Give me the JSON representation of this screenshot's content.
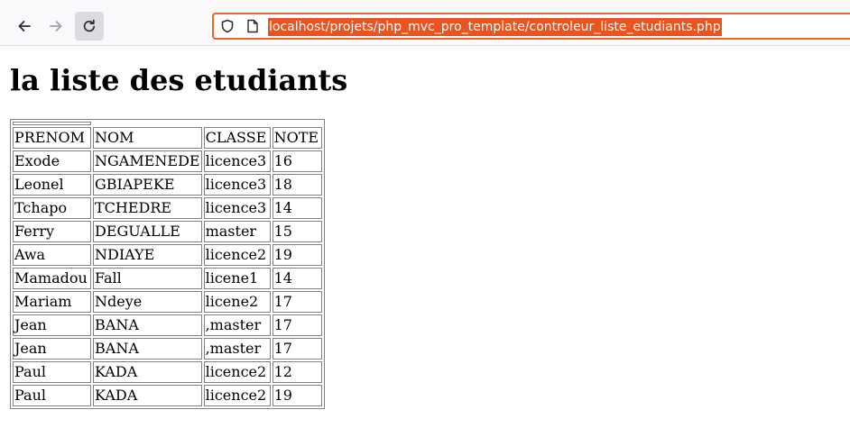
{
  "browser": {
    "url": "localhost/projets/php_mvc_pro_template/controleur_liste_etudiants.php",
    "icons": {
      "back": "arrow-left-icon",
      "forward": "arrow-right-icon",
      "reload": "reload-icon",
      "security": "shield-icon",
      "page": "page-icon"
    },
    "accent_color": "#e95420"
  },
  "page": {
    "title": "la liste des etudiants"
  },
  "table": {
    "headers": [
      "PRENOM",
      "NOM",
      "CLASSE",
      "NOTE"
    ],
    "rows": [
      [
        "Exode",
        "NGAMENEDE",
        "licence3",
        "16"
      ],
      [
        "Leonel",
        "GBIAPEKE",
        "licence3",
        "18"
      ],
      [
        "Tchapo",
        "TCHEDRE",
        "licence3",
        "14"
      ],
      [
        "Ferry",
        "DEGUALLE",
        "master",
        "15"
      ],
      [
        "Awa",
        "NDIAYE",
        "licence2",
        "19"
      ],
      [
        "Mamadou",
        "Fall",
        "licene1",
        "14"
      ],
      [
        "Mariam",
        "Ndeye",
        "licene2",
        "17"
      ],
      [
        "Jean",
        "BANA",
        ",master",
        "17"
      ],
      [
        "Jean",
        "BANA",
        ",master",
        "17"
      ],
      [
        "Paul",
        "KADA",
        "licence2",
        "12"
      ],
      [
        "Paul",
        "KADA",
        "licence2",
        "19"
      ]
    ]
  }
}
